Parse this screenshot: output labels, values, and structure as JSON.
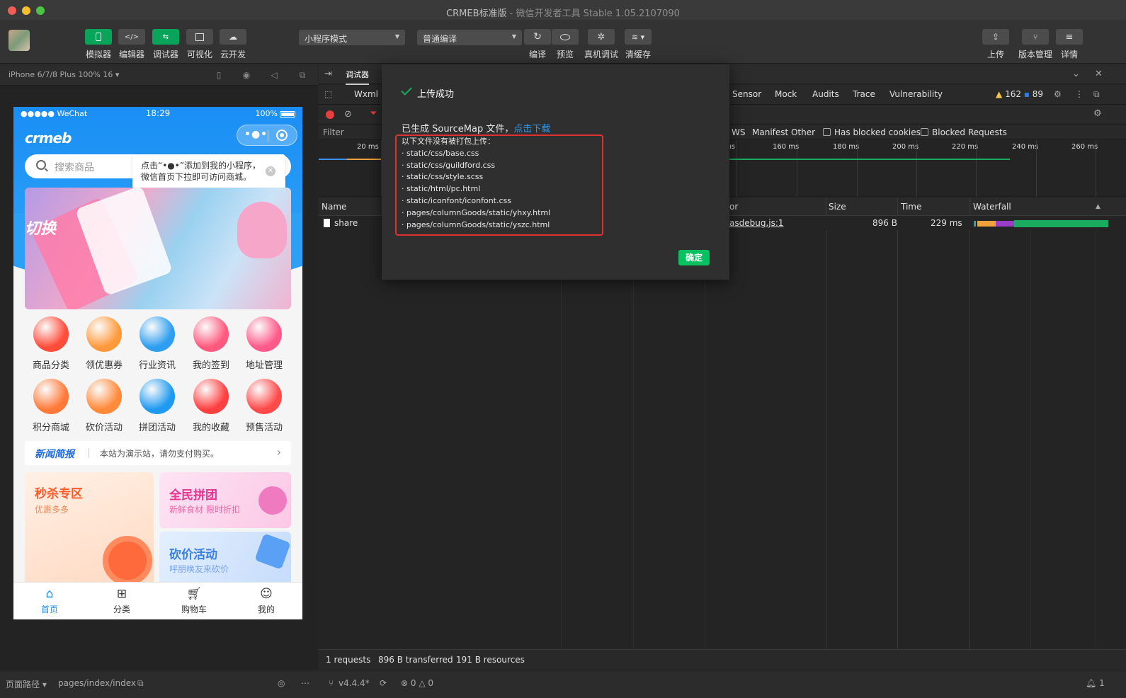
{
  "window": {
    "title": "CRMEB标准版",
    "subtitle": "- 微信开发者工具 Stable 1.05.2107090"
  },
  "toolbar": {
    "left_buttons": [
      {
        "label": "模拟器",
        "icon": "phone-icon",
        "active": true
      },
      {
        "label": "编辑器",
        "icon": "code-icon",
        "active": false
      },
      {
        "label": "调试器",
        "icon": "debugger-icon",
        "active": true
      },
      {
        "label": "可视化",
        "icon": "layout-icon",
        "active": false
      },
      {
        "label": "云开发",
        "icon": "cloud-icon",
        "active": false
      }
    ],
    "mode_select": "小程序模式",
    "compile_select": "普通编译",
    "mid_buttons": [
      {
        "label": "编译",
        "icon": "refresh-icon"
      },
      {
        "label": "预览",
        "icon": "eye-icon"
      },
      {
        "label": "真机调试",
        "icon": "bug-icon"
      },
      {
        "label": "清缓存",
        "icon": "layers-icon"
      }
    ],
    "right_buttons": [
      {
        "label": "上传",
        "icon": "upload-icon"
      },
      {
        "label": "版本管理",
        "icon": "branch-icon"
      },
      {
        "label": "详情",
        "icon": "menu-icon"
      }
    ]
  },
  "simulator": {
    "device": "iPhone 6/7/8 Plus 100% 16 ▾",
    "status": {
      "carrier": "●●●●● WeChat",
      "time": "18:29",
      "battery": "100%"
    },
    "logo": "crmeb",
    "search_placeholder": "搜索商品",
    "tip": {
      "line1": "点击“•●•”添加到我的小程序，",
      "line2": "微信首页下拉即可访问商城。"
    },
    "banner_text": "切换",
    "icons": [
      {
        "label": "商品分类",
        "color": "#ff4d3a"
      },
      {
        "label": "领优惠券",
        "color": "#ff9a3c"
      },
      {
        "label": "行业资讯",
        "color": "#2d9ef0"
      },
      {
        "label": "我的签到",
        "color": "#ff5a7e"
      },
      {
        "label": "地址管理",
        "color": "#ff5a8a"
      },
      {
        "label": "积分商城",
        "color": "#ff7a3a"
      },
      {
        "label": "砍价活动",
        "color": "#ff8a3a"
      },
      {
        "label": "拼团活动",
        "color": "#1f9af0"
      },
      {
        "label": "我的收藏",
        "color": "#ff4040"
      },
      {
        "label": "预售活动",
        "color": "#ff4a4a"
      }
    ],
    "news": {
      "title": "新闻简报",
      "text": "本站为演示站，请勿支付购买。"
    },
    "cards": [
      {
        "title": "秒杀专区",
        "sub": "优惠多多",
        "color": "#ff5a2a"
      },
      {
        "title": "全民拼团",
        "sub": "新鲜食材 限时折扣",
        "color": "#e8358f"
      },
      {
        "title": "砍价活动",
        "sub": "呼朋唤友来砍价",
        "color": "#3a7fe8"
      }
    ],
    "tabs": [
      {
        "label": "首页",
        "icon": "home-icon",
        "active": true
      },
      {
        "label": "分类",
        "icon": "grid-icon",
        "active": false
      },
      {
        "label": "购物车",
        "icon": "cart-icon",
        "active": false
      },
      {
        "label": "我的",
        "icon": "user-icon",
        "active": false
      }
    ]
  },
  "bottom": {
    "path_label": "页面路径 ▾",
    "path": "pages/index/index",
    "version": "v4.4.4*",
    "errors": "0",
    "warnings": "0",
    "notifications": "1"
  },
  "devtools": {
    "tab": "调试器",
    "panel_tabs_left": [
      "Wxml"
    ],
    "panel_tabs_right": [
      "Sensor",
      "Mock",
      "Audits",
      "Trace",
      "Vulnerability"
    ],
    "warn_count": "162",
    "info_count": "89",
    "filter_label": "Filter",
    "filter_types": [
      "WS",
      "Manifest",
      "Other"
    ],
    "checkboxes": [
      "Has blocked cookies",
      "Blocked Requests"
    ],
    "ticks": [
      "20 ms",
      "ıs",
      "160 ms",
      "180 ms",
      "200 ms",
      "220 ms",
      "240 ms",
      "260 ms"
    ],
    "columns": {
      "name": "Name",
      "initiator": "or",
      "size": "Size",
      "time": "Time",
      "waterfall": "Waterfall"
    },
    "row": {
      "name": "share",
      "initiator": "asdebug.js:1",
      "size": "896 B",
      "time": "229 ms"
    },
    "footer": {
      "requests": "1 requests",
      "transferred": "896 B transferred",
      "resources": "191 B resources"
    }
  },
  "modal": {
    "title": "上传成功",
    "generated": "已生成 SourceMap 文件，",
    "download_link": "点击下载",
    "list_title": "以下文件没有被打包上传：",
    "files": [
      "· static/css/base.css",
      "· static/css/guildford.css",
      "· static/css/style.scss",
      "· static/html/pc.html",
      "· static/iconfont/iconfont.css",
      "· pages/columnGoods/static/yhxy.html",
      "· pages/columnGoods/static/yszc.html"
    ],
    "ok_label": "确定"
  }
}
